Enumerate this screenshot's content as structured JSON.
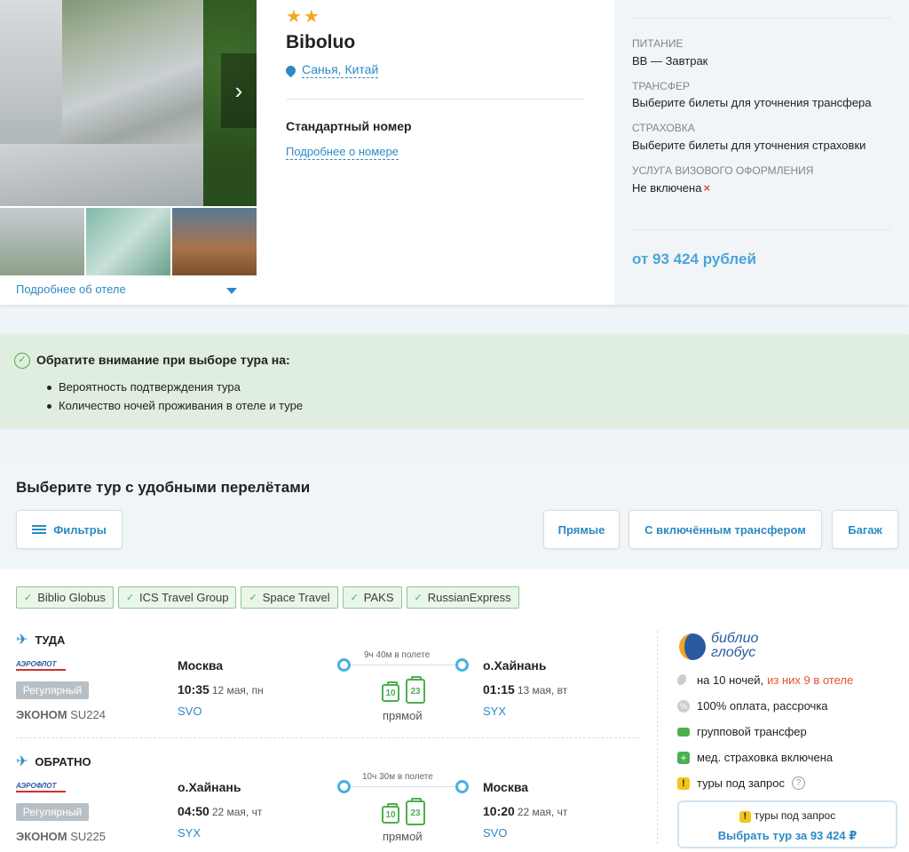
{
  "hotel": {
    "stars": "★★",
    "name": "Biboluo",
    "location": "Санья, Китай",
    "more_link": "Подробнее об отеле",
    "room_name": "Стандартный номер",
    "room_link": "Подробнее о номере"
  },
  "side": {
    "meal_label": "Питание",
    "meal_value": "BB — Завтрак",
    "transfer_label": "Трансфер",
    "transfer_value": "Выберите билеты для уточнения трансфера",
    "insurance_label": "Страховка",
    "insurance_value": "Выберите билеты для уточнения страховки",
    "visa_label": "Услуга визового оформления",
    "visa_value": "Не включена",
    "visa_mark": "×",
    "price": "от 93 424 рублей"
  },
  "notice": {
    "title": "Обратите внимание при выборе тура на:",
    "items": [
      "Вероятность подтверждения тура",
      "Количество ночей проживания в отеле и туре"
    ]
  },
  "choose": {
    "title": "Выберите тур с удобными перелётами",
    "filters": "Фильтры",
    "direct": "Прямые",
    "transfer": "С включённым трансфером",
    "baggage": "Багаж"
  },
  "operators": [
    "Biblio Globus",
    "ICS Travel Group",
    "Space Travel",
    "PAKS",
    "RussianExpress"
  ],
  "there": {
    "label": "ТУДА",
    "airline": "АЭРОФЛОТ",
    "regular": "Регулярный",
    "class": "ЭКОНОМ",
    "flight": "SU224",
    "from_city": "Москва",
    "from_time": "10:35",
    "from_date": "12 мая, пн",
    "from_code": "SVO",
    "duration": "9ч 40м в полете",
    "bag1": "10",
    "bag2": "23",
    "direct": "прямой",
    "to_city": "о.Хайнань",
    "to_time": "01:15",
    "to_date": "13 мая, вт",
    "to_code": "SYX"
  },
  "back": {
    "label": "ОБРАТНО",
    "airline": "АЭРОФЛОТ",
    "regular": "Регулярный",
    "class": "ЭКОНОМ",
    "flight": "SU225",
    "from_city": "о.Хайнань",
    "from_time": "04:50",
    "from_date": "22 мая, чт",
    "from_code": "SYX",
    "duration": "10ч 30м в полете",
    "bag1": "10",
    "bag2": "23",
    "direct": "прямой",
    "to_city": "Москва",
    "to_time": "10:20",
    "to_date": "22 мая, чт",
    "to_code": "SVO"
  },
  "offer": {
    "logo_line1": "библио",
    "logo_line2": "глобус",
    "nights": "на 10 ночей,",
    "nights_hotel": "из них 9 в отеле",
    "payment": "100% оплата, рассрочка",
    "transfer": "групповой трансфер",
    "insurance": "мед. страховка включена",
    "request": "туры под запрос",
    "box_request": "туры под запрос",
    "box_button": "Выбрать тур за 93 424 ₽"
  }
}
